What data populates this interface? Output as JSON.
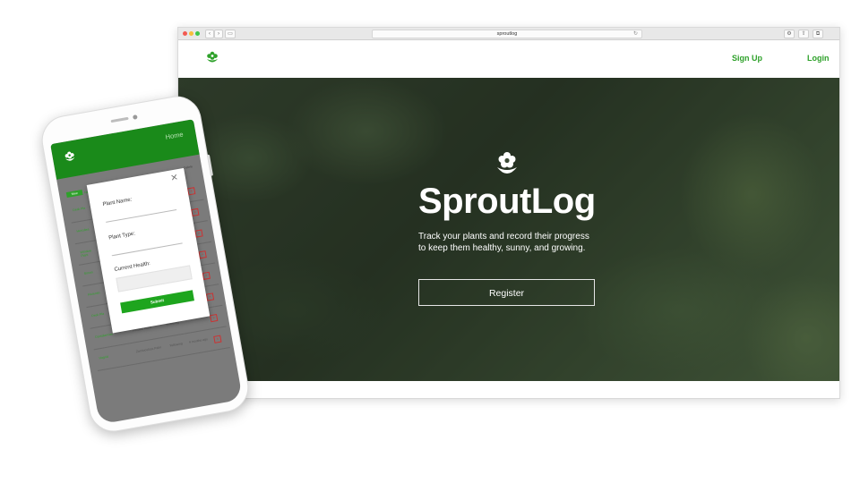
{
  "browser": {
    "url": "sproutlog",
    "reload_glyph": "↻",
    "toolbar_glyphs": {
      "back": "‹",
      "forward": "›",
      "sidebar": "▭",
      "share": "⇧",
      "tabs": "⧉",
      "settings": "⚙"
    }
  },
  "site": {
    "nav": {
      "signup_label": "Sign Up",
      "login_label": "Login"
    },
    "hero": {
      "title": "SproutLog",
      "tagline": "Track your plants and record their progress to keep them healthy, sunny, and growing.",
      "register_label": "Register"
    }
  },
  "phone": {
    "header": {
      "home_label": "Home"
    },
    "table": {
      "new_label": "New",
      "name_header": "Name",
      "delete_header": "Delete",
      "rows": [
        {
          "name": "Desk Pla",
          "col2": "",
          "col3": "",
          "col4": ""
        },
        {
          "name": "Herculea",
          "col2": "",
          "col3": "",
          "col4": ""
        },
        {
          "name": "Window Plant",
          "col2": "",
          "col3": "",
          "col4": ""
        },
        {
          "name": "Simon",
          "col2": "",
          "col3": "",
          "col4": ""
        },
        {
          "name": "Florentin",
          "col2": "",
          "col3": "",
          "col4": ""
        },
        {
          "name": "Desk Pla",
          "col2": "",
          "col3": "",
          "col4": ""
        },
        {
          "name": "Dantalamian",
          "col2": "Window Plant",
          "col3": "Yellowing",
          "col4": ""
        },
        {
          "name": "Hagrid",
          "col2": "Zamioculcas Palm",
          "col3": "Yellowing",
          "col4": "4 months ago"
        }
      ]
    },
    "modal": {
      "close_glyph": "✕",
      "plant_name_label": "Plant Name:",
      "plant_type_label": "Plant Type:",
      "current_health_label": "Current Health:",
      "submit_label": "Submit"
    }
  },
  "colors": {
    "brand_green": "#2ea12a",
    "header_green": "#1a8a1a",
    "submit_green": "#1ea51e"
  }
}
